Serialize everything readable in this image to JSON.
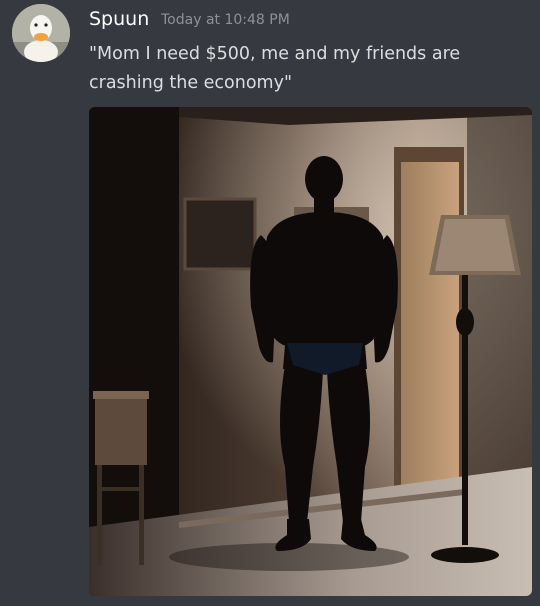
{
  "message": {
    "author": "Spuun",
    "timestamp": "Today at 10:48 PM",
    "content": "\"Mom I need $500, me and my friends are crashing the economy\""
  },
  "avatar": {
    "icon": "duck-avatar-icon"
  },
  "attachment": {
    "icon": "photo-attachment"
  }
}
